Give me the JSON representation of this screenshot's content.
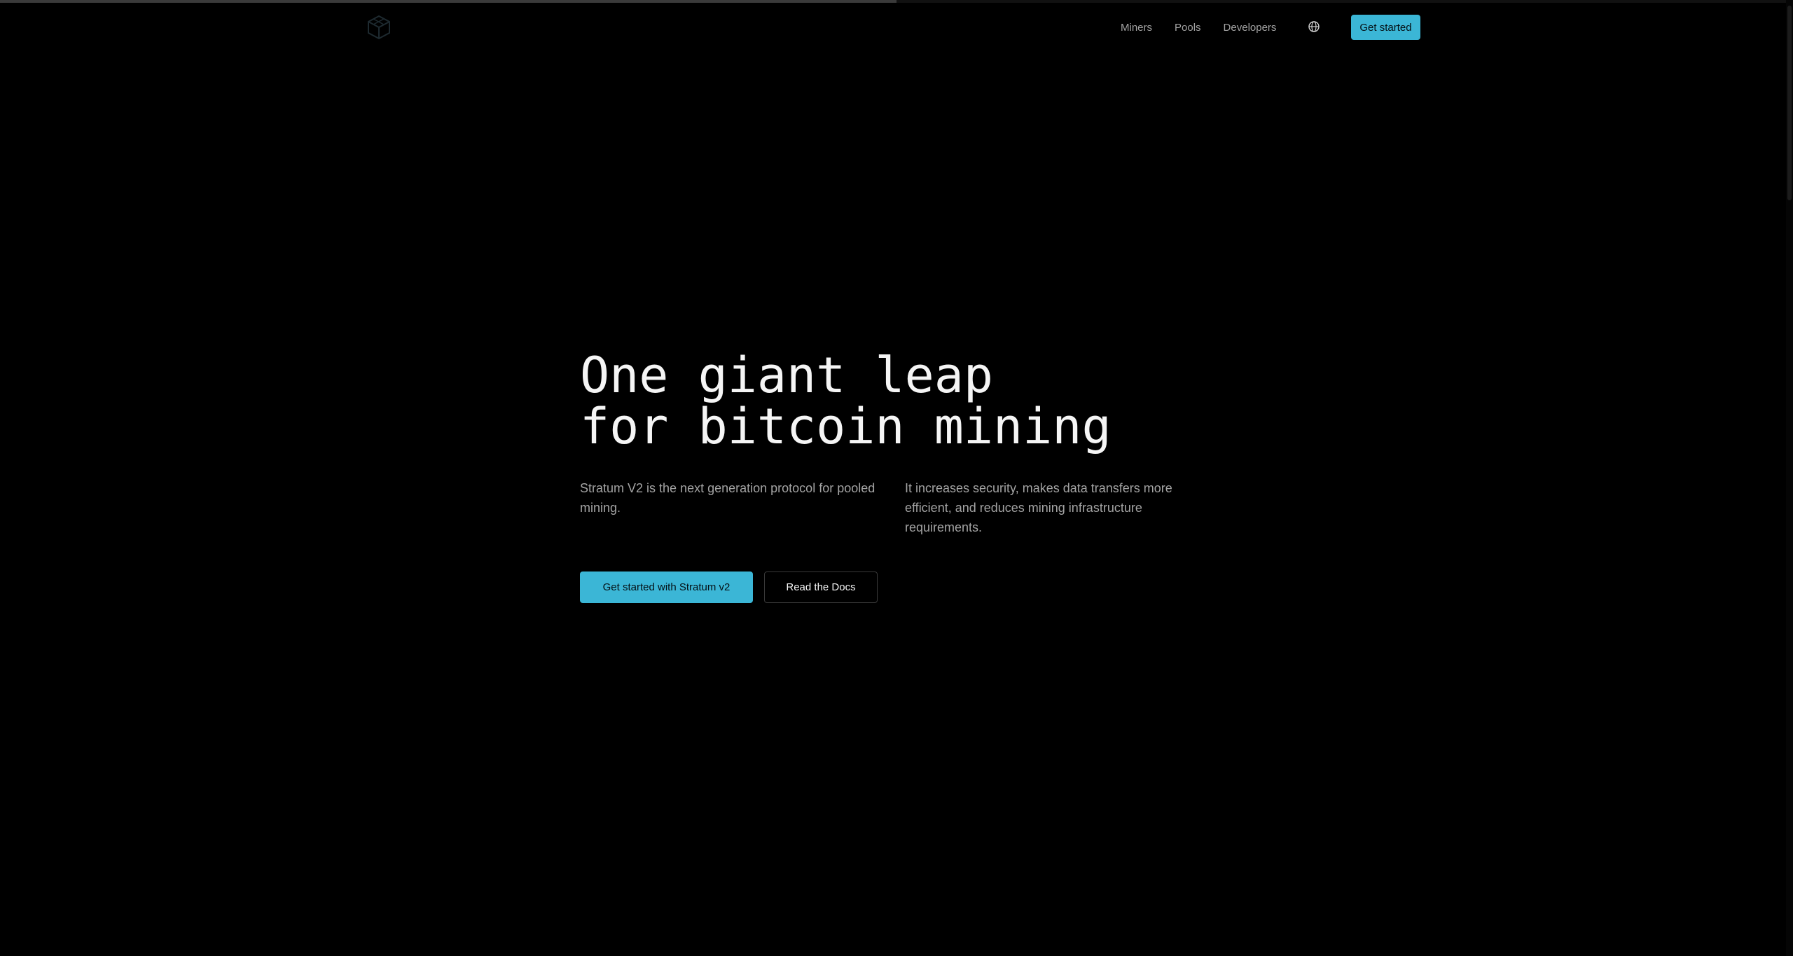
{
  "nav": {
    "links": [
      {
        "label": "Miners"
      },
      {
        "label": "Pools"
      },
      {
        "label": "Developers"
      }
    ],
    "language_icon": "globe-icon",
    "cta_label": "Get started"
  },
  "hero": {
    "title_line1": "One giant leap",
    "title_line2": "for bitcoin mining",
    "description_left": "Stratum V2 is the next generation protocol for pooled mining.",
    "description_right": "It increases security, makes data transfers more efficient, and reduces mining infrastructure requirements.",
    "primary_cta": "Get started with Stratum v2",
    "secondary_cta": "Read the Docs"
  },
  "page_scroll_progress": 0.5,
  "colors": {
    "background": "#000000",
    "accent": "#3bb6d6",
    "text_primary": "#f5f5f5",
    "text_muted": "#a3a3a3"
  }
}
